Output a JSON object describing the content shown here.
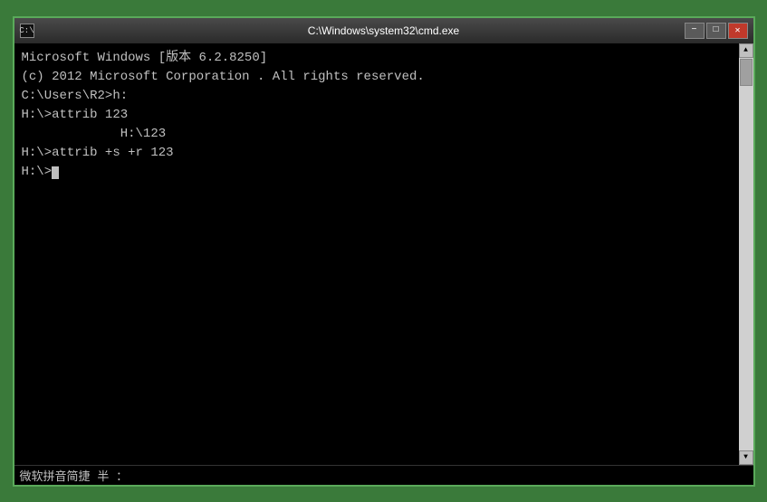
{
  "titlebar": {
    "title": "C:\\Windows\\system32\\cmd.exe",
    "icon": "C:\\",
    "minimize_label": "−",
    "maximize_label": "□",
    "close_label": "✕"
  },
  "terminal": {
    "lines": [
      "Microsoft Windows [版本 6.2.8250]",
      "(c) 2012 Microsoft Corporation . All rights reserved.",
      "",
      "C:\\Users\\R2>h:",
      "",
      "H:\\>attrib 123",
      "             H:\\123",
      "",
      "H:\\>attrib +s +r 123",
      "",
      "H:\\>"
    ]
  },
  "statusbar": {
    "text": "微软拼音简捷  半  ："
  }
}
